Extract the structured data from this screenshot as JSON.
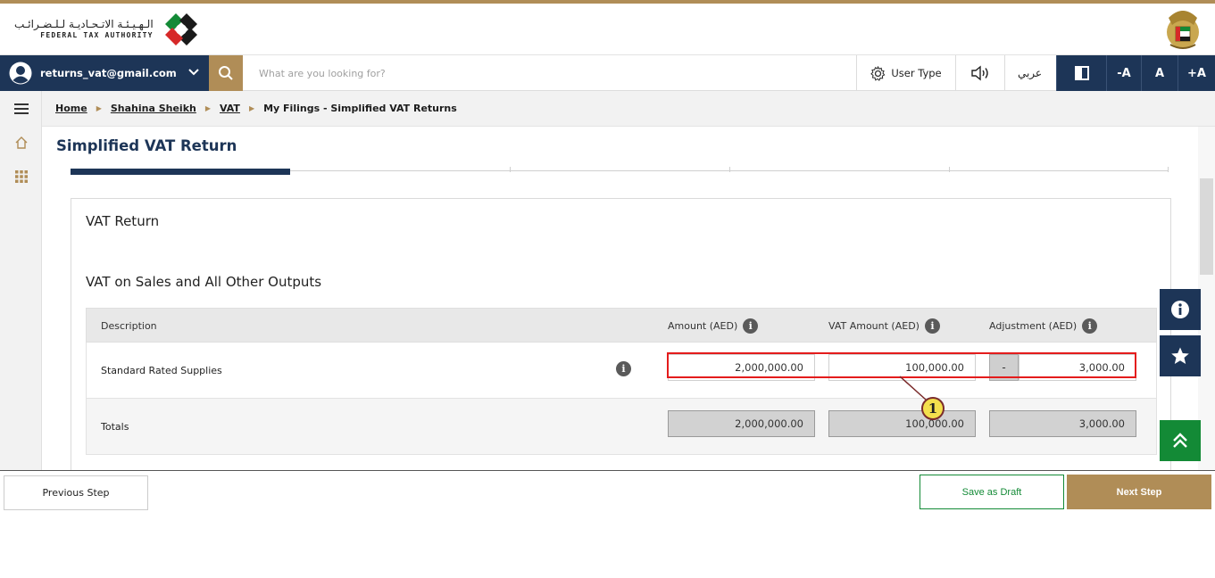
{
  "header": {
    "org_name_ar": "الـهـيـئـة الاتـحـاديـة لـلـضـرائـب",
    "org_name_en": "FEDERAL TAX AUTHORITY"
  },
  "navbar": {
    "user_email": "returns_vat@gmail.com",
    "search_placeholder": "What are you looking for?",
    "user_type_label": "User Type",
    "arabic_label": "عربي",
    "font_decrease": "-A",
    "font_reset": "A",
    "font_increase": "+A"
  },
  "breadcrumb": {
    "items": [
      "Home",
      "Shahina Sheikh",
      "VAT"
    ],
    "current": "My Filings - Simplified VAT Returns"
  },
  "page": {
    "title": "Simplified VAT Return",
    "stepper_active_step": 1,
    "stepper_total_steps": 5
  },
  "card": {
    "title": "VAT Return",
    "section_title": "VAT on Sales and All Other Outputs",
    "columns": {
      "description": "Description",
      "amount": "Amount (AED)",
      "vat_amount": "VAT Amount (AED)",
      "adjustment": "Adjustment (AED)"
    },
    "rows": [
      {
        "label": "Standard Rated Supplies",
        "amount": "2,000,000.00",
        "vat_amount": "100,000.00",
        "adjustment_sign": "-",
        "adjustment": "3,000.00"
      }
    ],
    "totals": {
      "label": "Totals",
      "amount": "2,000,000.00",
      "vat_amount": "100,000.00",
      "adjustment": "3,000.00"
    }
  },
  "annotation": {
    "callout_number": "1",
    "highlight_color": "#e41c1c"
  },
  "footer": {
    "previous_label": "Previous Step",
    "draft_label": "Save as Draft",
    "next_label": "Next Step"
  },
  "colors": {
    "navy": "#1d3557",
    "gold": "#b08d57",
    "green": "#138a36"
  }
}
